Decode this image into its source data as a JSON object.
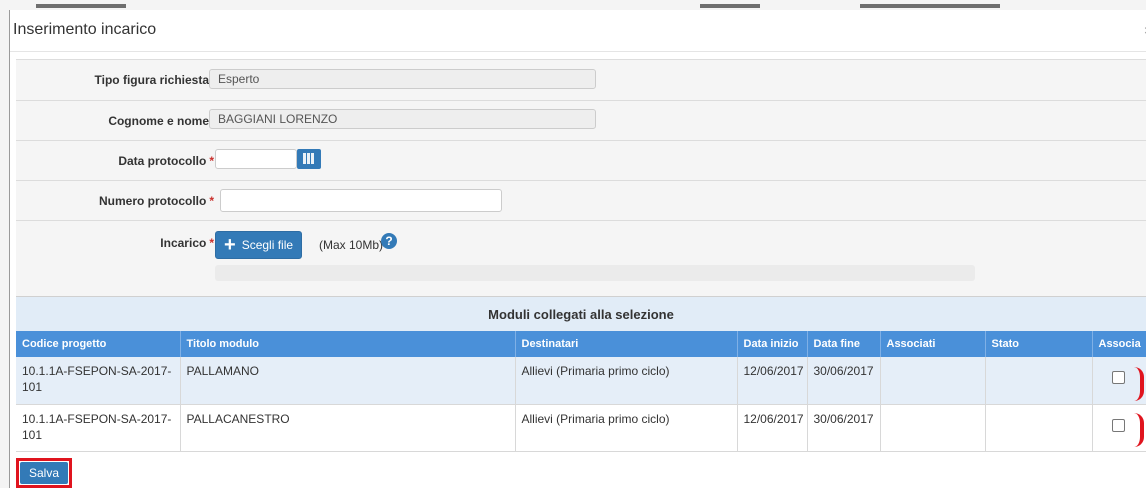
{
  "modal": {
    "title": "Inserimento incarico"
  },
  "form": {
    "tipo_figura": {
      "label": "Tipo figura richiesta",
      "value": "Esperto"
    },
    "cognome_nome": {
      "label": "Cognome e nome",
      "value": "BAGGIANI LORENZO"
    },
    "data_protocollo": {
      "label": "Data protocollo",
      "required_mark": "*",
      "value": ""
    },
    "numero_protocollo": {
      "label": "Numero protocollo",
      "required_mark": "*",
      "value": ""
    },
    "incarico": {
      "label": "Incarico",
      "required_mark": "*",
      "file_button_label": "Scegli file",
      "max_size": "(Max 10Mb)",
      "help_glyph": "?"
    }
  },
  "moduli": {
    "section_title": "Moduli collegati alla selezione",
    "columns": [
      "Codice progetto",
      "Titolo modulo",
      "Destinatari",
      "Data inizio",
      "Data fine",
      "Associati",
      "Stato",
      "Associa"
    ],
    "rows": [
      {
        "codice": "10.1.1A-FSEPON-SA-2017-101",
        "titolo": "PALLAMANO",
        "destinatari": "Allievi (Primaria primo ciclo)",
        "data_inizio": "12/06/2017",
        "data_fine": "30/06/2017",
        "associati": "",
        "stato": "",
        "associa_checked": false
      },
      {
        "codice": "10.1.1A-FSEPON-SA-2017-101",
        "titolo": "PALLACANESTRO",
        "destinatari": "Allievi (Primaria primo ciclo)",
        "data_inizio": "12/06/2017",
        "data_fine": "30/06/2017",
        "associati": "",
        "stato": "",
        "associa_checked": false
      }
    ]
  },
  "actions": {
    "save_label": "Salva"
  },
  "colors": {
    "primary": "#337ab7",
    "table_header": "#4a90d9",
    "highlight": "#e0141e",
    "row_alt": "#e5eef8"
  }
}
